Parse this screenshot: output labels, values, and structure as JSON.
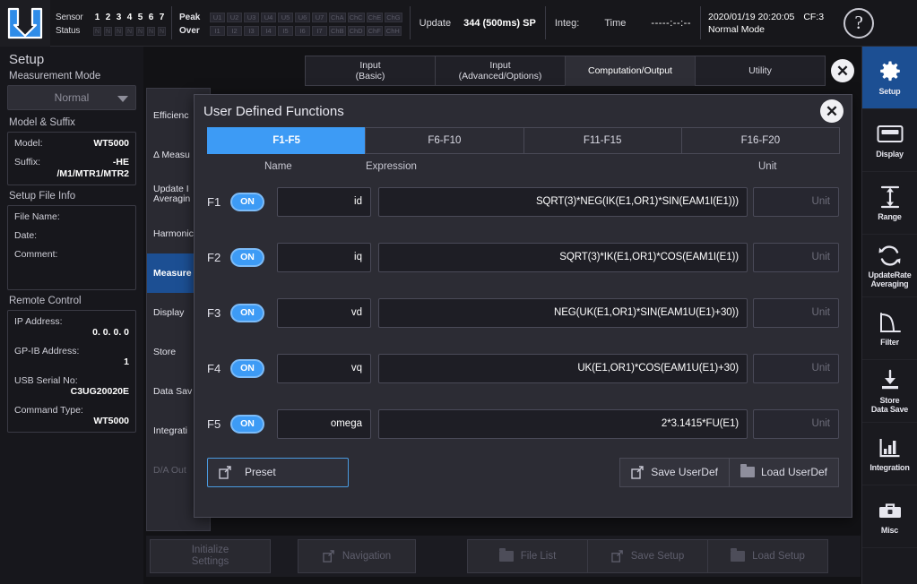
{
  "topbar": {
    "sensor_label": "Sensor",
    "status_label": "Status",
    "sensor_numbers": [
      "1",
      "2",
      "3",
      "4",
      "5",
      "6",
      "7"
    ],
    "status_cells": [
      "N",
      "N",
      "N",
      "N",
      "N",
      "N",
      "N"
    ],
    "peak_label": "Peak",
    "over_label": "Over",
    "peak_cells": [
      "U1",
      "U2",
      "U3",
      "U4",
      "U5",
      "U6",
      "U7",
      "ChA",
      "ChC",
      "ChE",
      "ChG"
    ],
    "over_cells": [
      "I1",
      "I2",
      "I3",
      "I4",
      "I5",
      "I6",
      "I7",
      "ChB",
      "ChD",
      "ChF",
      "ChH"
    ],
    "update_label": "Update",
    "update_value": "344 (500ms) SP",
    "integ_label": "Integ:",
    "time_label": "Time",
    "time_value": "-----:--:--",
    "datetime": "2020/01/19 20:20:05",
    "cf": "CF:3",
    "mode": "Normal Mode",
    "help_icon": "question-mark-icon"
  },
  "left_panel": {
    "title": "Setup",
    "measurement_mode_label": "Measurement Mode",
    "measurement_mode_value": "Normal",
    "model_suffix_label": "Model & Suffix",
    "model_key": "Model:",
    "model_value": "WT5000",
    "suffix_key": "Suffix:",
    "suffix_value_1": "-HE",
    "suffix_value_2": "/M1/MTR1/MTR2",
    "setup_file_label": "Setup File Info",
    "file_name_key": "File Name:",
    "file_name_value": "",
    "date_key": "Date:",
    "date_value": "",
    "comment_key": "Comment:",
    "comment_value": "",
    "remote_label": "Remote Control",
    "ip_key": "IP Address:",
    "ip_value": "0. 0. 0. 0",
    "gpib_key": "GP-IB Address:",
    "gpib_value": "1",
    "usb_key": "USB Serial No:",
    "usb_value": "C3UG20020E",
    "cmdtype_key": "Command Type:",
    "cmdtype_value": "WT5000"
  },
  "tabs": [
    {
      "line1": "Input",
      "line2": "(Basic)",
      "active": false
    },
    {
      "line1": "Input",
      "line2": "(Advanced/Options)",
      "active": false
    },
    {
      "line1": "Computation/Output",
      "line2": "",
      "active": true
    },
    {
      "line1": "Utility",
      "line2": "",
      "active": false
    }
  ],
  "tab_close_icon": "close-icon",
  "submenu": [
    {
      "label": "Efficienc",
      "state": "normal"
    },
    {
      "label": "Δ Measu",
      "state": "normal"
    },
    {
      "label": "Update I\nAveragin",
      "state": "normal"
    },
    {
      "label": "Harmonic",
      "state": "normal"
    },
    {
      "label": "Measure",
      "state": "active"
    },
    {
      "label": "Display",
      "state": "normal"
    },
    {
      "label": "Store",
      "state": "normal"
    },
    {
      "label": "Data Sav",
      "state": "normal"
    },
    {
      "label": "Integrati",
      "state": "normal"
    },
    {
      "label": "D/A Out",
      "state": "disabled"
    }
  ],
  "dialog": {
    "title": "User Defined Functions",
    "close_icon": "close-icon",
    "tabs": [
      {
        "label": "F1-F5",
        "active": true
      },
      {
        "label": "F6-F10",
        "active": false
      },
      {
        "label": "F11-F15",
        "active": false
      },
      {
        "label": "F16-F20",
        "active": false
      }
    ],
    "columns": {
      "name": "Name",
      "expression": "Expression",
      "unit": "Unit"
    },
    "rows": [
      {
        "id": "F1",
        "toggle": "ON",
        "name": "id",
        "expression": "SQRT(3)*NEG(IK(E1,OR1)*SIN(EAM1I(E1)))",
        "unit": "Unit"
      },
      {
        "id": "F2",
        "toggle": "ON",
        "name": "iq",
        "expression": "SQRT(3)*IK(E1,OR1)*COS(EAM1I(E1))",
        "unit": "Unit"
      },
      {
        "id": "F3",
        "toggle": "ON",
        "name": "vd",
        "expression": "NEG(UK(E1,OR1)*SIN(EAM1U(E1)+30))",
        "unit": "Unit"
      },
      {
        "id": "F4",
        "toggle": "ON",
        "name": "vq",
        "expression": "UK(E1,OR1)*COS(EAM1U(E1)+30)",
        "unit": "Unit"
      },
      {
        "id": "F5",
        "toggle": "ON",
        "name": "omega",
        "expression": "2*3.1415*FU(E1)",
        "unit": "Unit"
      }
    ],
    "preset_label": "Preset",
    "preset_icon": "external-window-icon",
    "save_userdef_label": "Save UserDef",
    "save_userdef_icon": "external-window-icon",
    "load_userdef_label": "Load UserDef",
    "load_userdef_icon": "folder-icon"
  },
  "bottombar": {
    "initialize_label": "Initialize\nSettings",
    "navigation_label": "Navigation",
    "navigation_icon": "external-window-icon",
    "file_list_label": "File List",
    "file_list_icon": "folder-icon",
    "save_setup_label": "Save Setup",
    "save_setup_icon": "external-window-icon",
    "load_setup_label": "Load Setup",
    "load_setup_icon": "folder-icon"
  },
  "rightbar": [
    {
      "label": "Setup",
      "icon": "gear-icon",
      "active": true
    },
    {
      "label": "Display",
      "icon": "monitor-icon",
      "active": false
    },
    {
      "label": "Range",
      "icon": "vertical-arrows-icon",
      "active": false
    },
    {
      "label": "UpdateRate\nAveraging",
      "icon": "refresh-cycle-icon",
      "active": false
    },
    {
      "label": "Filter",
      "icon": "filter-curve-icon",
      "active": false
    },
    {
      "label": "Store\nData Save",
      "icon": "download-icon",
      "active": false
    },
    {
      "label": "Integration",
      "icon": "bar-chart-icon",
      "active": false
    },
    {
      "label": "Misc",
      "icon": "toolbox-icon",
      "active": false
    }
  ],
  "colors": {
    "accent_blue": "#3d9bf5",
    "selection_blue": "#1c4f93",
    "panel_bg": "#2c2c34",
    "window_bg": "#17171c"
  }
}
